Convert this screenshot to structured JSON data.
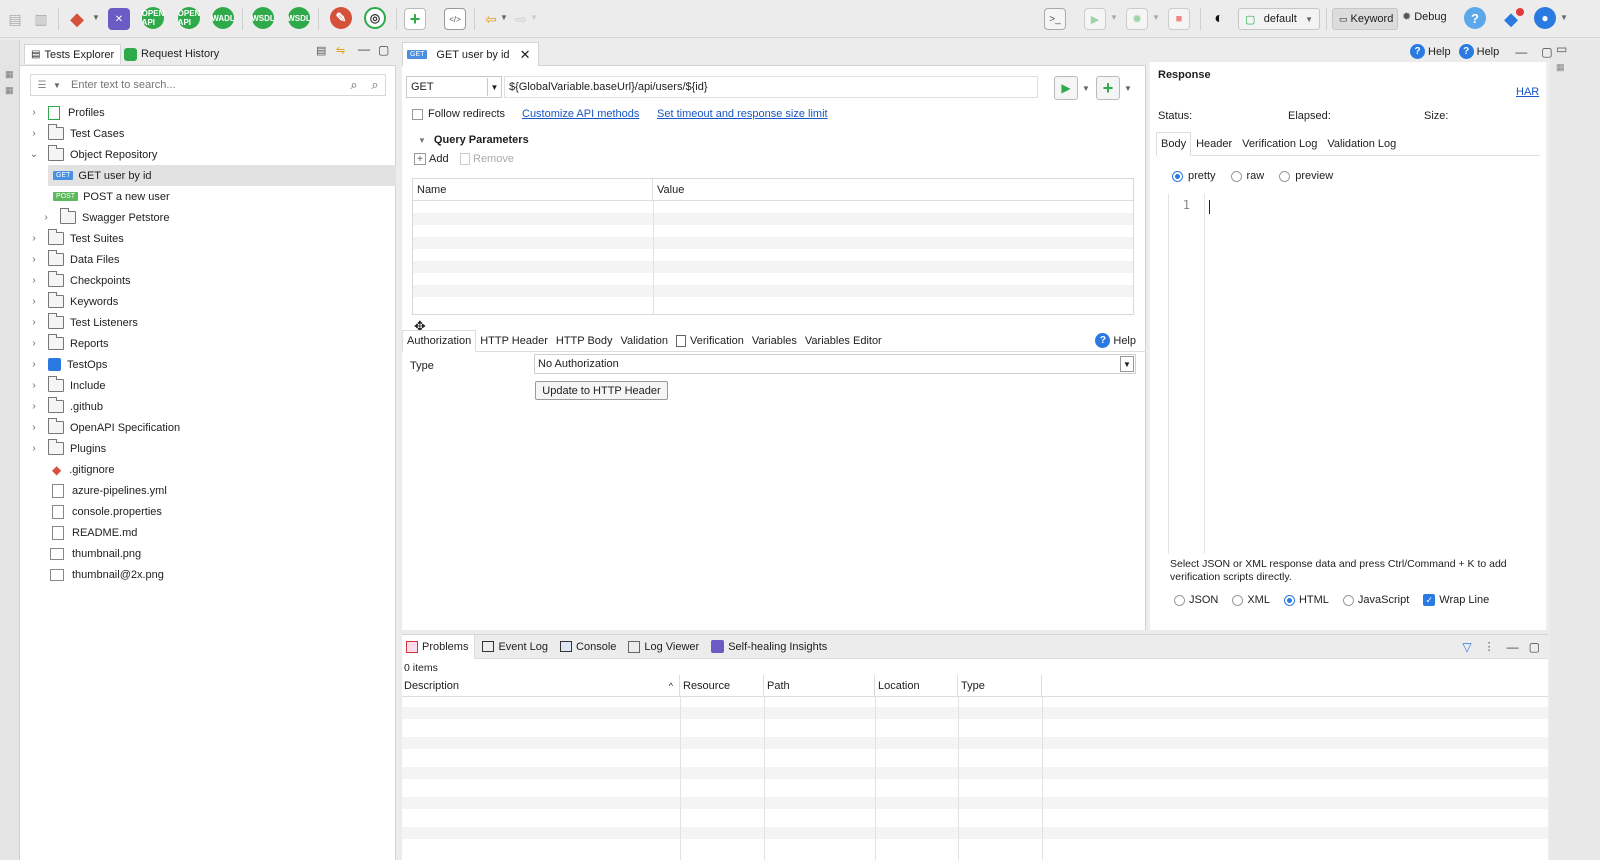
{
  "toolbar": {
    "profile_label": "default",
    "keyword_label": "Keyword",
    "debug_label": "Debug",
    "icon_texts": [
      "OPEN API",
      "OPEN API",
      "WADL",
      "WSDL",
      "WSDL"
    ],
    "brand_colors": {
      "git": "#d6513a",
      "green": "#2faa4a",
      "purple": "#6a5cc4",
      "accent": "#2a7ae2"
    }
  },
  "left_panel": {
    "tabs": [
      {
        "label": "Tests Explorer"
      },
      {
        "label": "Request History"
      }
    ],
    "search_placeholder": "Enter text to search...",
    "tree": [
      {
        "label": "Profiles"
      },
      {
        "label": "Test Cases"
      },
      {
        "label": "Object Repository"
      },
      {
        "label": "GET user by id",
        "badge": "GET"
      },
      {
        "label": "POST a new user",
        "badge": "POST"
      },
      {
        "label": "Swagger Petstore"
      },
      {
        "label": "Test Suites"
      },
      {
        "label": "Data Files"
      },
      {
        "label": "Checkpoints"
      },
      {
        "label": "Keywords"
      },
      {
        "label": "Test Listeners"
      },
      {
        "label": "Reports"
      },
      {
        "label": "TestOps"
      },
      {
        "label": "Include"
      },
      {
        "label": ".github"
      },
      {
        "label": "OpenAPI Specification"
      },
      {
        "label": "Plugins"
      },
      {
        "label": ".gitignore"
      },
      {
        "label": "azure-pipelines.yml"
      },
      {
        "label": "console.properties"
      },
      {
        "label": "README.md"
      },
      {
        "label": "thumbnail.png"
      },
      {
        "label": "thumbnail@2x.png"
      }
    ]
  },
  "editor": {
    "tab_badge": "GET",
    "tab_title": "GET user by id",
    "method": "GET",
    "url": "${GlobalVariable.baseUrl}/api/users/${id}",
    "follow_redirects": "Follow redirects",
    "customize_link": "Customize API methods",
    "timeout_link": "Set timeout and response size limit",
    "query_params_title": "Query Parameters",
    "add_label": "Add",
    "remove_label": "Remove",
    "col_name": "Name",
    "col_value": "Value",
    "sub_tabs": [
      "Authorization",
      "HTTP Header",
      "HTTP Body",
      "Validation",
      "Verification",
      "Variables",
      "Variables Editor"
    ],
    "help_label": "Help",
    "type_label": "Type",
    "auth_type_value": "No Authorization",
    "update_button": "Update to HTTP Header"
  },
  "response": {
    "title": "Response",
    "har": "HAR",
    "status": "Status:",
    "elapsed": "Elapsed:",
    "size": "Size:",
    "tabs": [
      "Body",
      "Header",
      "Verification Log",
      "Validation Log"
    ],
    "views": [
      "pretty",
      "raw",
      "preview"
    ],
    "line_number": "1",
    "hint": "Select JSON or XML response data and press Ctrl/Command + K to add verification scripts directly.",
    "formats": [
      "JSON",
      "XML",
      "HTML",
      "JavaScript"
    ],
    "wrap_line": "Wrap Line"
  },
  "top_right": {
    "help1": "Help",
    "help2": "Help"
  },
  "bottom": {
    "tabs": [
      "Problems",
      "Event Log",
      "Console",
      "Log Viewer",
      "Self-healing Insights"
    ],
    "items_count": "0 items",
    "columns": [
      "Description",
      "Resource",
      "Path",
      "Location",
      "Type"
    ]
  }
}
